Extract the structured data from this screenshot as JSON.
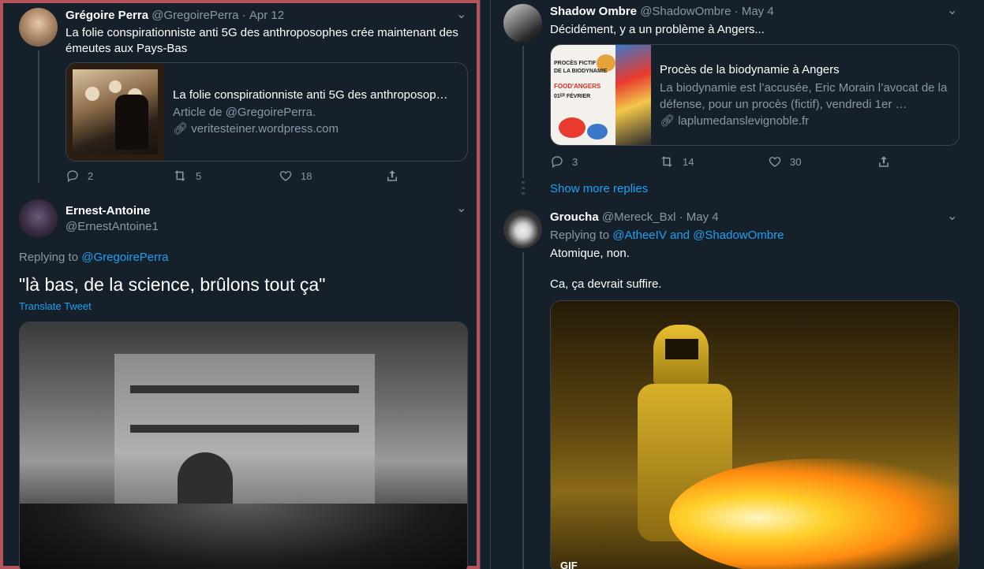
{
  "left": {
    "tweet1": {
      "name": "Grégoire Perra",
      "handle": "@GregoirePerra",
      "date": "Apr 12",
      "text": "La folie conspirationniste anti 5G des anthroposophes crée maintenant des émeutes aux Pays-Bas",
      "card": {
        "title": "La folie conspirationniste anti 5G des anthroposop…",
        "desc": "Article de @GregoirePerra.",
        "domain": "veritesteiner.wordpress.com"
      },
      "replies": "2",
      "retweets": "5",
      "likes": "18"
    },
    "tweet2": {
      "name": "Ernest-Antoine",
      "handle": "@ErnestAntoine1",
      "replying_label": "Replying to",
      "replying_to": "@GregoirePerra",
      "text": "\"là bas, de la science, brûlons tout ça\"",
      "translate": "Translate Tweet"
    }
  },
  "right": {
    "tweet1": {
      "name": "Shadow Ombre",
      "handle": "@ShadowOmbre",
      "date": "May 4",
      "text": "Décidément, y a un problème à Angers...",
      "card": {
        "title": "Procès de la biodynamie à Angers",
        "desc": "La biodynamie est l’accusée, Eric Morain l’avocat de la défense, pour un procès (fictif), vendredi 1er …",
        "domain": "laplumedanslevignoble.fr",
        "thumb_lines": [
          "PROCÈS FICTIF",
          "DE LA BIODYNAMIE",
          "FOOD'ANGERS",
          "01ᴱᴿ FÉVRIER"
        ]
      },
      "replies": "3",
      "retweets": "14",
      "likes": "30",
      "show_more": "Show more replies"
    },
    "tweet2": {
      "name": "Groucha",
      "handle": "@Mereck_Bxl",
      "date": "May 4",
      "replying_label": "Replying to",
      "replying_to": "@AtheeIV and @ShadowOmbre",
      "line1": "Atomique, non.",
      "line2": "Ca, ça devrait suffire.",
      "gif_label": "GIF"
    }
  },
  "colors": {
    "background": "#15202b",
    "secondary_text": "#8899a6",
    "accent": "#1da1f2",
    "border": "#38444d"
  }
}
